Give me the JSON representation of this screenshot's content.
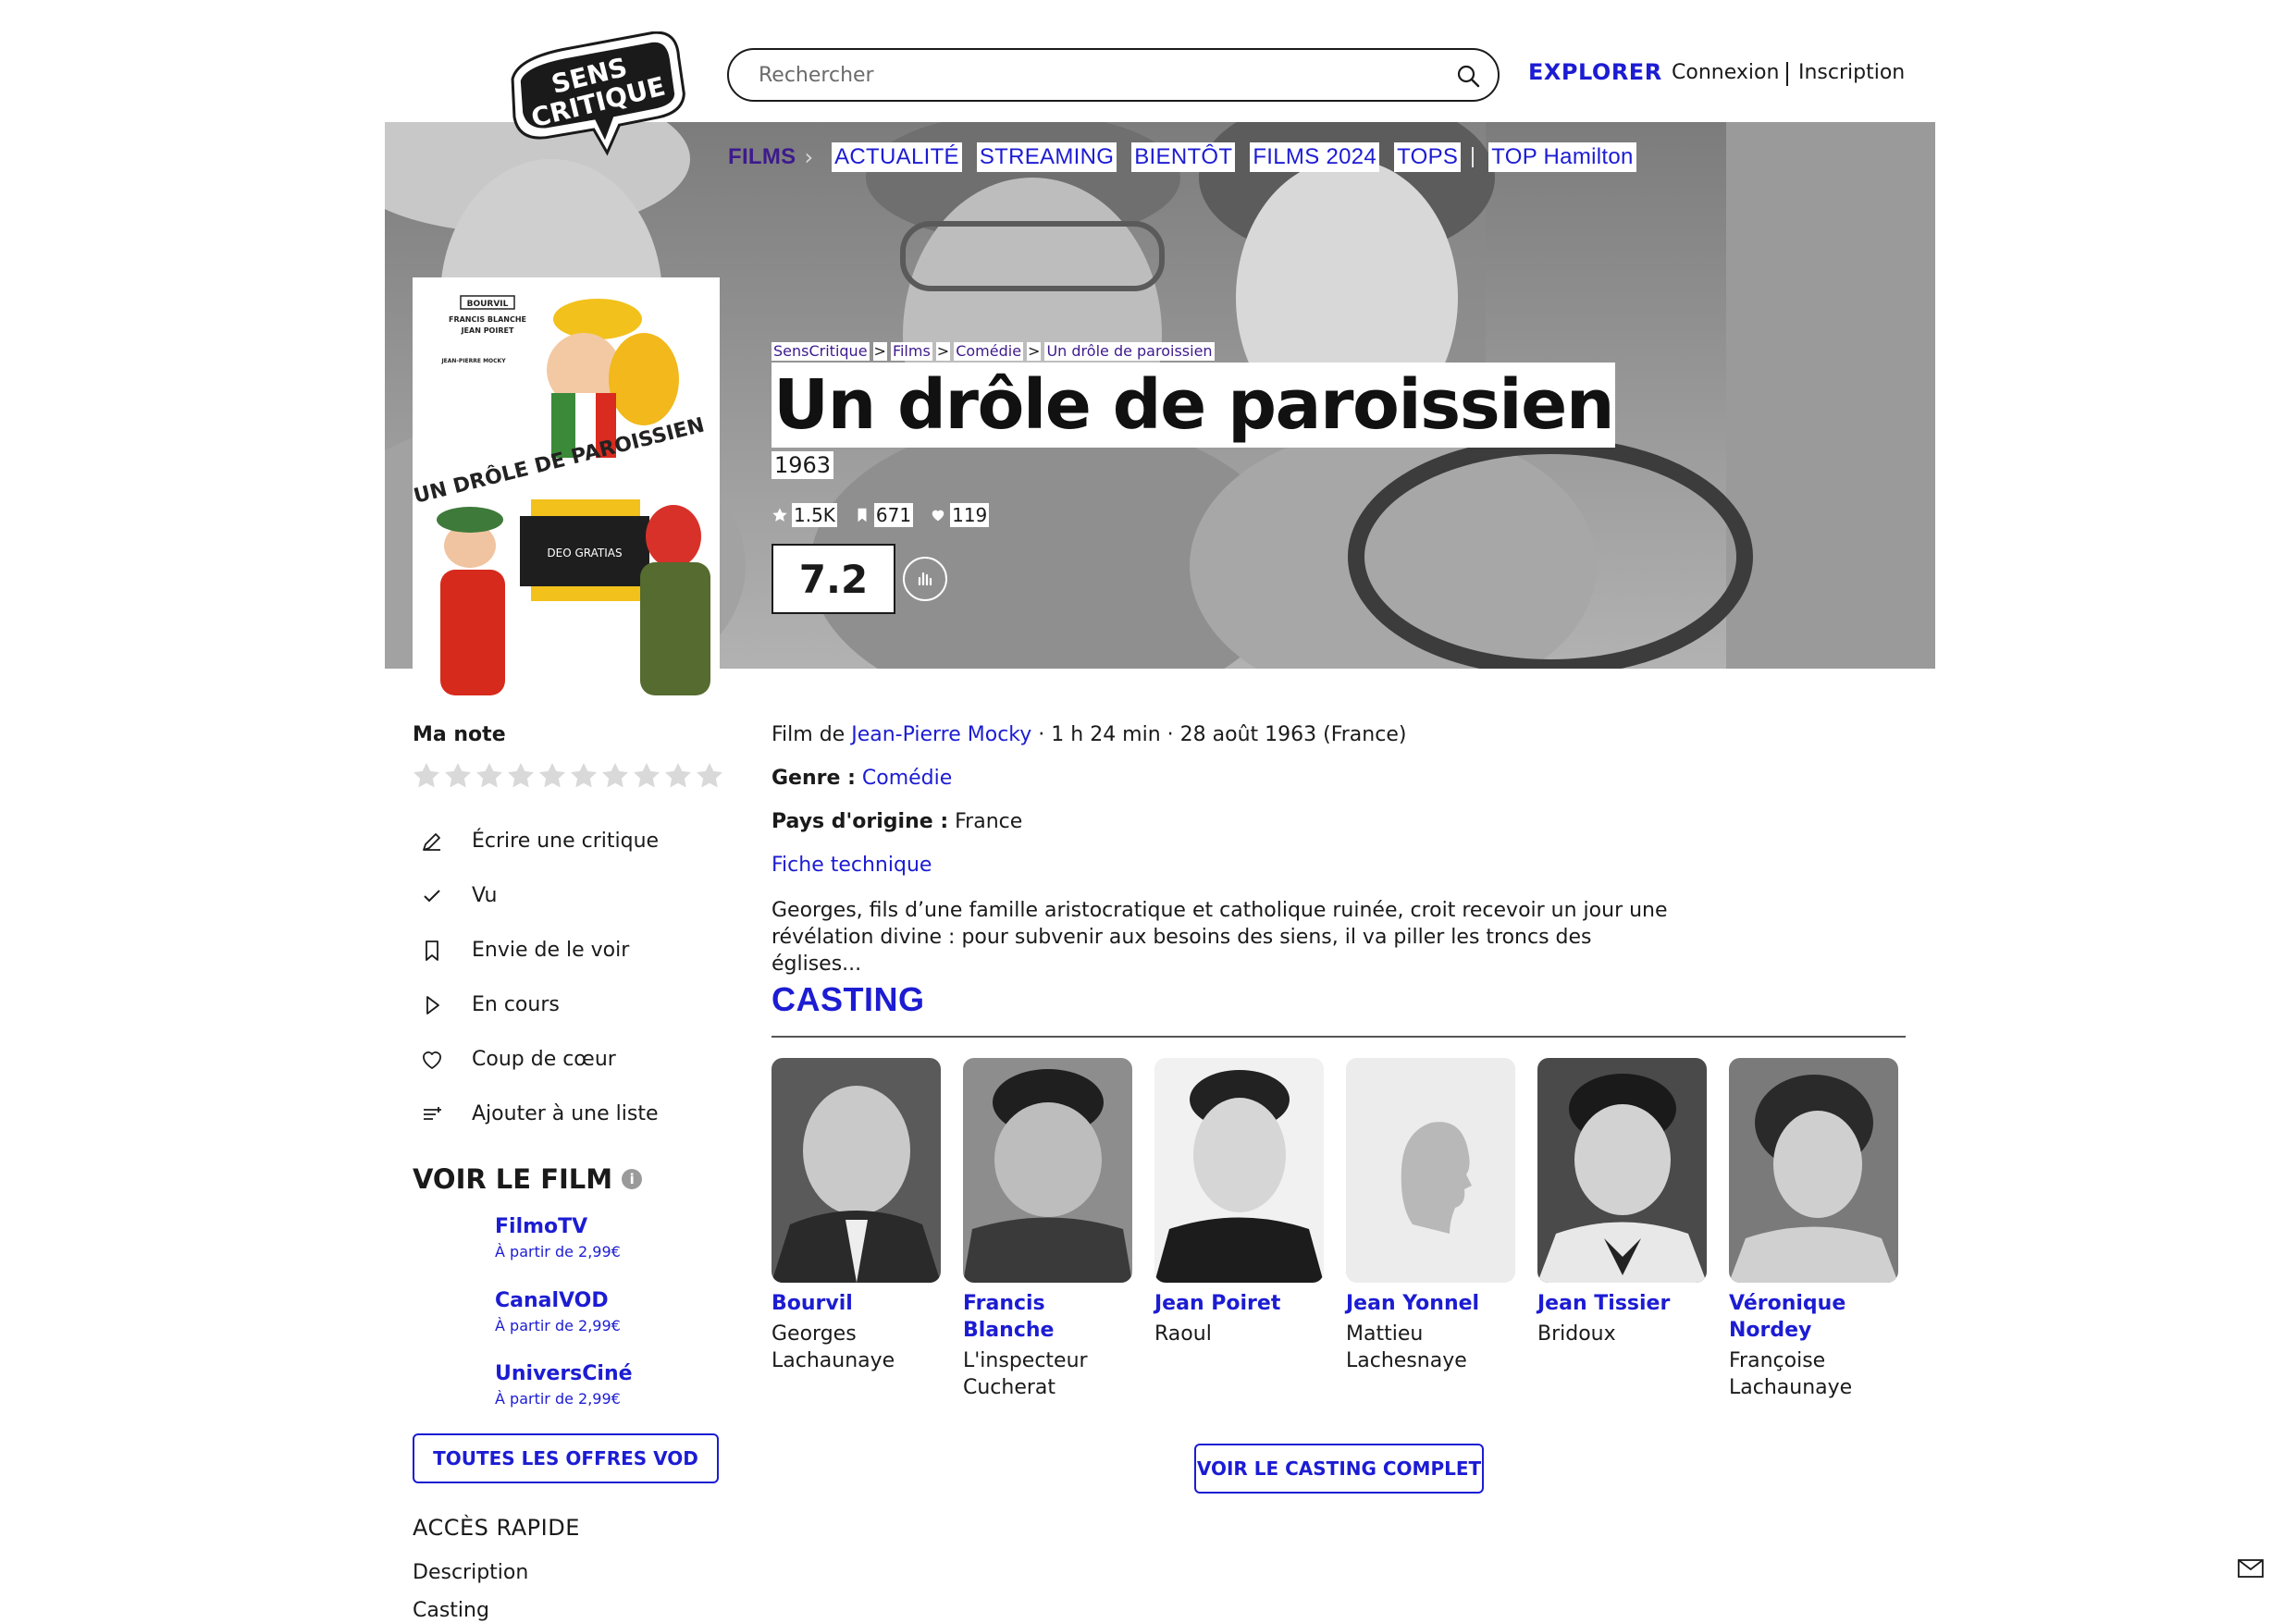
{
  "header": {
    "search_placeholder": "Rechercher",
    "explore": "EXPLORER",
    "login": "Connexion",
    "signup": "Inscription"
  },
  "nav": {
    "films": "FILMS",
    "items": [
      "ACTUALITÉ",
      "STREAMING",
      "BIENTÔT",
      "FILMS 2024",
      "TOPS",
      "TOP Hamilton"
    ]
  },
  "breadcrumb": [
    "SensCritique",
    "Films",
    "Comédie",
    "Un drôle de paroissien"
  ],
  "movie": {
    "title": "Un drôle de paroissien",
    "year": "1963",
    "ratings_count": "1.5K",
    "wishlist_count": "671",
    "favorites_count": "119",
    "score": "7.2",
    "director_prefix": "Film de",
    "director": "Jean-Pierre Mocky",
    "details": "· 1 h 24 min · 28 août 1963 (France)",
    "genre_label": "Genre :",
    "genre": "Comédie",
    "country_label": "Pays d'origine :",
    "country": "France",
    "fiche": "Fiche technique",
    "synopsis": "Georges, fils d’une famille aristocratique et catholique ruinée, croit recevoir un jour une révélation divine : pour subvenir aux besoins des siens, il va piller les troncs des églises..."
  },
  "poster": {
    "credit_1": "BOURVIL",
    "credit_2": "FRANCIS BLANCHE",
    "credit_3": "JEAN POIRET",
    "credit_4": "JEAN-PIERRE MOCKY",
    "title": "UN DRÔLE DE PAROISSIEN",
    "box": "DEO GRATIAS"
  },
  "sidebar": {
    "my_rating": "Ma note",
    "actions": [
      {
        "label": "Écrire une critique",
        "icon": "pencil-icon"
      },
      {
        "label": "Vu",
        "icon": "check-icon"
      },
      {
        "label": "Envie de le voir",
        "icon": "bookmark-icon"
      },
      {
        "label": "En cours",
        "icon": "play-icon"
      },
      {
        "label": "Coup de cœur",
        "icon": "heart-icon"
      },
      {
        "label": "Ajouter à une liste",
        "icon": "list-add-icon"
      }
    ],
    "watch_title": "VOIR LE FILM",
    "vod": [
      {
        "name": "FilmoTV",
        "price": "À partir de 2,99€"
      },
      {
        "name": "CanalVOD",
        "price": "À partir de 2,99€"
      },
      {
        "name": "UniversCiné",
        "price": "À partir de 2,99€"
      }
    ],
    "all_vod": "TOUTES LES OFFRES VOD",
    "quick_title": "ACCÈS RAPIDE",
    "quick": [
      "Description",
      "Casting"
    ]
  },
  "casting": {
    "title": "CASTING",
    "members": [
      {
        "name": "Bourvil",
        "role": "Georges Lachaunaye"
      },
      {
        "name": "Francis Blanche",
        "role": "L'inspecteur Cucherat"
      },
      {
        "name": "Jean Poiret",
        "role": "Raoul"
      },
      {
        "name": "Jean Yonnel",
        "role": "Mattieu Lachesnaye"
      },
      {
        "name": "Jean Tissier",
        "role": "Bridoux"
      },
      {
        "name": "Véronique Nordey",
        "role": "Françoise Lachaunaye"
      }
    ],
    "see_all": "VOIR LE CASTING COMPLET"
  },
  "colors": {
    "accent": "#1c1cd3",
    "purple": "#3d1a8c",
    "text": "#1a1a1a"
  }
}
